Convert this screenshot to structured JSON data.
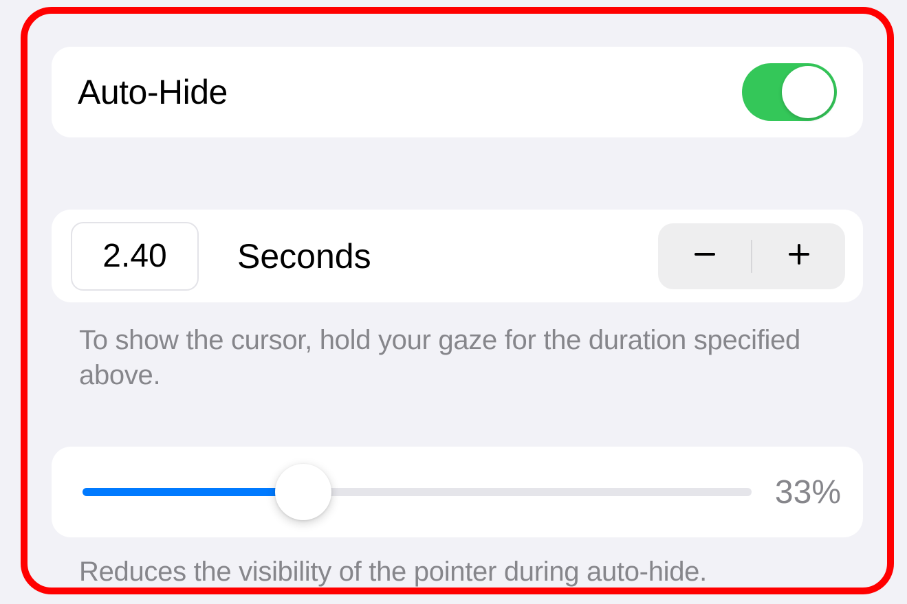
{
  "autoHide": {
    "label": "Auto-Hide",
    "enabled": true
  },
  "duration": {
    "value": "2.40",
    "unitLabel": "Seconds",
    "helpText": "To show the cursor, hold your gaze for the duration specified above."
  },
  "opacity": {
    "percent": 33,
    "percentLabel": "33%",
    "helpText": "Reduces the visibility of the pointer during auto-hide."
  },
  "colors": {
    "accent": "#007aff",
    "toggleOn": "#34c759",
    "highlightBorder": "#ff0000"
  }
}
